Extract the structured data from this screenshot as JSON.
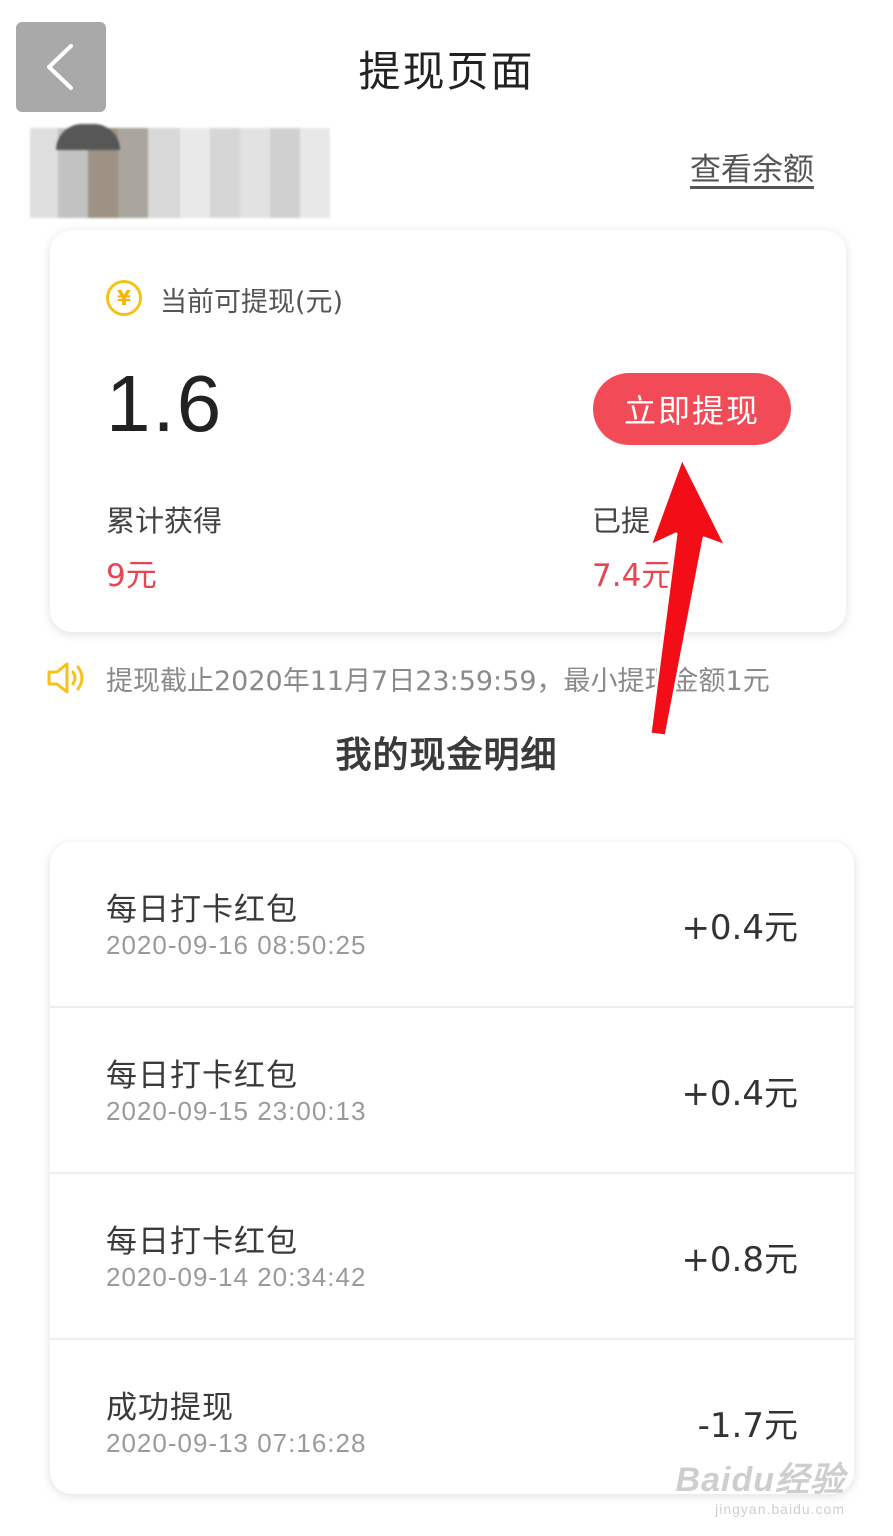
{
  "header": {
    "back_icon": "chevron-left-icon",
    "title": "提现页面"
  },
  "user": {
    "view_balance_label": "查看余额"
  },
  "balance": {
    "icon": "yuan-coin-icon",
    "icon_glyph": "¥",
    "label": "当前可提现(元)",
    "amount": "1.6",
    "withdraw_button_label": "立即提现",
    "total_earned_label": "累计获得",
    "total_earned_value": "9元",
    "withdrawn_label": "已提",
    "withdrawn_value": "7.4元"
  },
  "notice": {
    "icon": "speaker-icon",
    "text": "提现截止2020年11月7日23:59:59，最小提现金额1元"
  },
  "records_section": {
    "title": "我的现金明细",
    "items": [
      {
        "title": "每日打卡红包",
        "time": "2020-09-16 08:50:25",
        "amount": "+0.4元"
      },
      {
        "title": "每日打卡红包",
        "time": "2020-09-15 23:00:13",
        "amount": "+0.4元"
      },
      {
        "title": "每日打卡红包",
        "time": "2020-09-14 20:34:42",
        "amount": "+0.8元"
      },
      {
        "title": "成功提现",
        "time": "2020-09-13 07:16:28",
        "amount": "-1.7元"
      }
    ]
  },
  "watermark": {
    "logo": "Baidu经验",
    "url": "jingyan.baidu.com"
  },
  "colors": {
    "accent_red": "#f34a57",
    "value_red": "#e84552",
    "coin_yellow": "#f5c21b",
    "arrow_red": "#f20d17"
  }
}
